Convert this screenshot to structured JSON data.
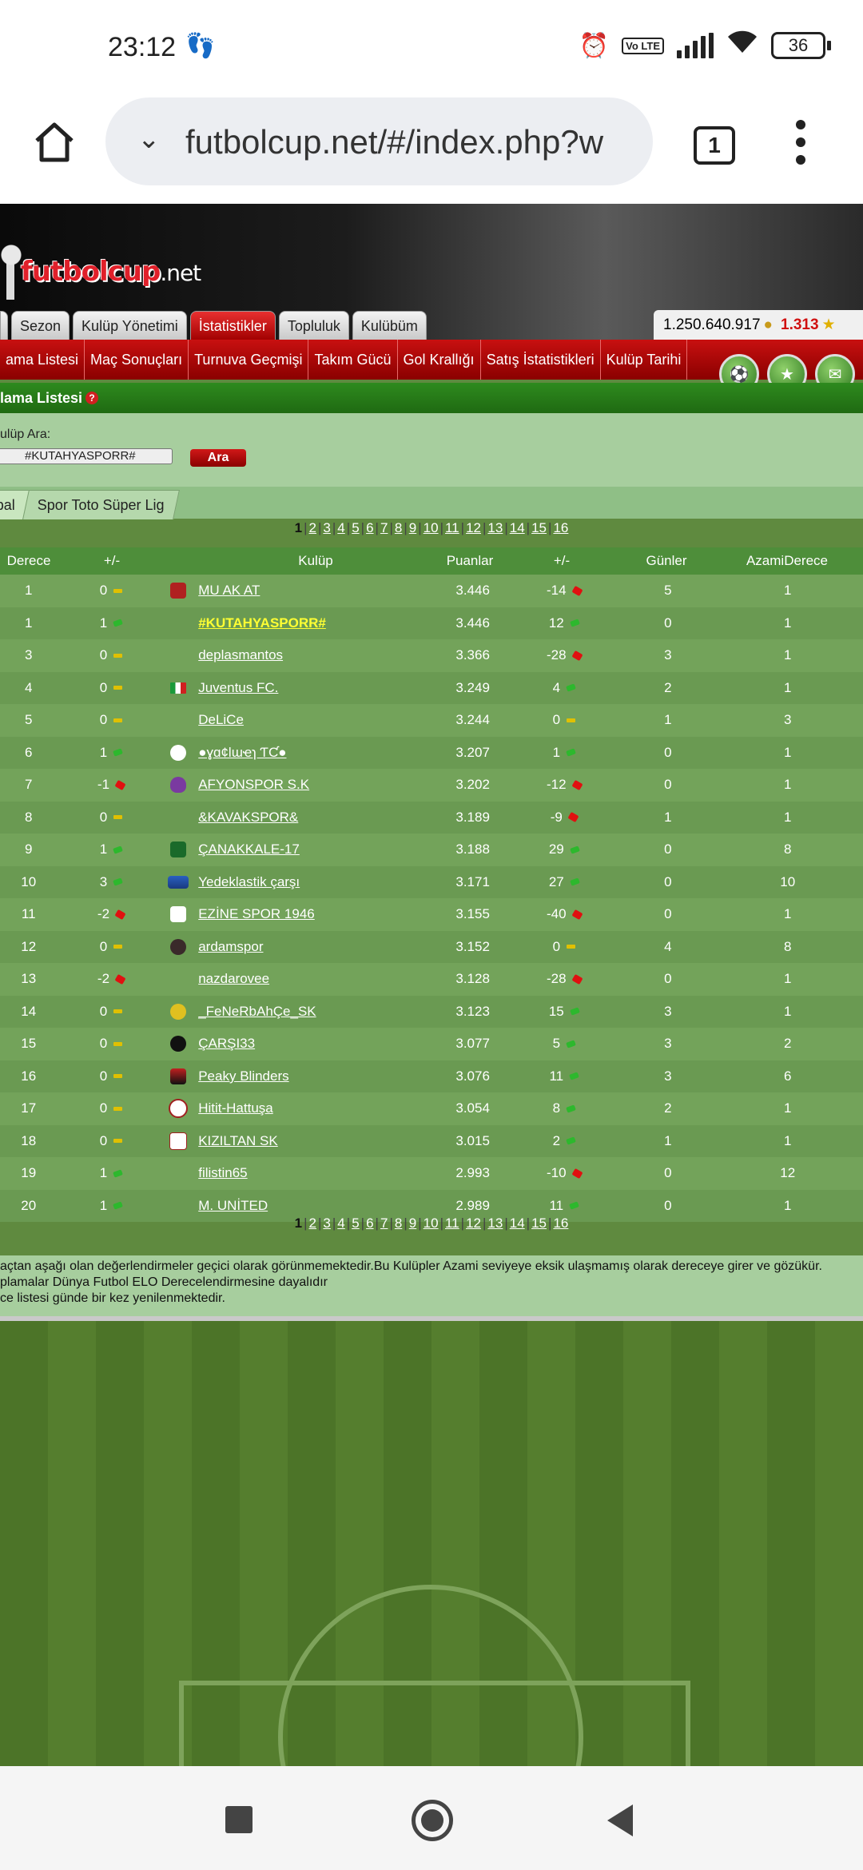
{
  "status": {
    "time": "23:12",
    "battery": "36",
    "volte": "Vo LTE"
  },
  "browser": {
    "url": "futbolcup.net/#/index.php?w",
    "tab_count": "1"
  },
  "site": {
    "logo": "futbolcup",
    "logo_suffix": ".net",
    "tabs": [
      {
        "label": "Sezon",
        "active": false
      },
      {
        "label": "Kulüp Yönetimi",
        "active": false
      },
      {
        "label": "İstatistikler",
        "active": true
      },
      {
        "label": "Topluluk",
        "active": false
      },
      {
        "label": "Kulübüm",
        "active": false
      }
    ],
    "money": "1.250.640.917",
    "points": "1.313",
    "subnav": [
      "ama Listesi",
      "Maç Sonuçları",
      "Turnuva Geçmişi",
      "Takım Gücü",
      "Gol Krallığı",
      "Satış İstatistikleri",
      "Kulüp Tarihi"
    ],
    "section_title": "lama Listesi",
    "search": {
      "label": "ulüp Ara:",
      "value": "#KUTAHYASPORR#",
      "button": "Ara"
    },
    "league_tabs": [
      {
        "label": "bal",
        "active": true
      },
      {
        "label": "Spor Toto Süper Lig",
        "active": false
      }
    ],
    "pager": {
      "current": "1",
      "pages": [
        "2",
        "3",
        "4",
        "5",
        "6",
        "7",
        "8",
        "9",
        "10",
        "11",
        "12",
        "13",
        "14",
        "15",
        "16"
      ]
    },
    "table": {
      "headers": {
        "derece": "Derece",
        "pm": "+/-",
        "club": "Kulüp",
        "puan": "Puanlar",
        "pm2": "+/-",
        "gun": "Günler",
        "azami": "AzamiDerece"
      },
      "rows": [
        {
          "derece": "1",
          "pm": "0",
          "pm_dir": "eq",
          "logo": "red",
          "club": "MU AK AT",
          "hl": false,
          "puan": "3.446",
          "pm2": "-14",
          "pm2_dir": "down",
          "gun": "5",
          "azami": "1"
        },
        {
          "derece": "1",
          "pm": "1",
          "pm_dir": "up",
          "logo": "",
          "club": "#KUTAHYASPORR#",
          "hl": true,
          "puan": "3.446",
          "pm2": "12",
          "pm2_dir": "up",
          "gun": "0",
          "azami": "1"
        },
        {
          "derece": "3",
          "pm": "0",
          "pm_dir": "eq",
          "logo": "",
          "club": "deplasmantos",
          "hl": false,
          "puan": "3.366",
          "pm2": "-28",
          "pm2_dir": "down",
          "gun": "3",
          "azami": "1"
        },
        {
          "derece": "4",
          "pm": "0",
          "pm_dir": "eq",
          "logo": "italy",
          "club": "Juventus FC.",
          "hl": false,
          "puan": "3.249",
          "pm2": "4",
          "pm2_dir": "up",
          "gun": "2",
          "azami": "1"
        },
        {
          "derece": "5",
          "pm": "0",
          "pm_dir": "eq",
          "logo": "",
          "club": "DeLiCe",
          "hl": false,
          "puan": "3.244",
          "pm2": "0",
          "pm2_dir": "eq",
          "gun": "1",
          "azami": "3"
        },
        {
          "derece": "6",
          "pm": "1",
          "pm_dir": "up",
          "logo": "ball",
          "club": "●ɣɑ¢Ɩɯҽɿ ƬƇ●",
          "hl": false,
          "puan": "3.207",
          "pm2": "1",
          "pm2_dir": "up",
          "gun": "0",
          "azami": "1"
        },
        {
          "derece": "7",
          "pm": "-1",
          "pm_dir": "down",
          "logo": "purple",
          "club": "AFYONSPOR S.K",
          "hl": false,
          "puan": "3.202",
          "pm2": "-12",
          "pm2_dir": "down",
          "gun": "0",
          "azami": "1"
        },
        {
          "derece": "8",
          "pm": "0",
          "pm_dir": "eq",
          "logo": "",
          "club": "&KAVAKSPOR&",
          "hl": false,
          "puan": "3.189",
          "pm2": "-9",
          "pm2_dir": "down",
          "gun": "1",
          "azami": "1"
        },
        {
          "derece": "9",
          "pm": "1",
          "pm_dir": "up",
          "logo": "green",
          "club": "ÇANAKKALE-17",
          "hl": false,
          "puan": "3.188",
          "pm2": "29",
          "pm2_dir": "up",
          "gun": "0",
          "azami": "8"
        },
        {
          "derece": "10",
          "pm": "3",
          "pm_dir": "up",
          "logo": "blue",
          "club": "Yedeklastik çarşı",
          "hl": false,
          "puan": "3.171",
          "pm2": "27",
          "pm2_dir": "up",
          "gun": "0",
          "azami": "10"
        },
        {
          "derece": "11",
          "pm": "-2",
          "pm_dir": "down",
          "logo": "white",
          "club": "EZİNE SPOR 1946",
          "hl": false,
          "puan": "3.155",
          "pm2": "-40",
          "pm2_dir": "down",
          "gun": "0",
          "azami": "1"
        },
        {
          "derece": "12",
          "pm": "0",
          "pm_dir": "eq",
          "logo": "dark",
          "club": "ardamspor",
          "hl": false,
          "puan": "3.152",
          "pm2": "0",
          "pm2_dir": "eq",
          "gun": "4",
          "azami": "8"
        },
        {
          "derece": "13",
          "pm": "-2",
          "pm_dir": "down",
          "logo": "",
          "club": "nazdarovee",
          "hl": false,
          "puan": "3.128",
          "pm2": "-28",
          "pm2_dir": "down",
          "gun": "0",
          "azami": "1"
        },
        {
          "derece": "14",
          "pm": "0",
          "pm_dir": "eq",
          "logo": "yellow",
          "club": "_FeNeRbAhÇe_SK",
          "hl": false,
          "puan": "3.123",
          "pm2": "15",
          "pm2_dir": "up",
          "gun": "3",
          "azami": "1"
        },
        {
          "derece": "15",
          "pm": "0",
          "pm_dir": "eq",
          "logo": "black",
          "club": "ÇARŞI33",
          "hl": false,
          "puan": "3.077",
          "pm2": "5",
          "pm2_dir": "up",
          "gun": "3",
          "azami": "2"
        },
        {
          "derece": "16",
          "pm": "0",
          "pm_dir": "eq",
          "logo": "redblack",
          "club": "Peaky Blinders",
          "hl": false,
          "puan": "3.076",
          "pm2": "11",
          "pm2_dir": "up",
          "gun": "3",
          "azami": "6"
        },
        {
          "derece": "17",
          "pm": "0",
          "pm_dir": "eq",
          "logo": "circle",
          "club": "Hitit-Hattuşa",
          "hl": false,
          "puan": "3.054",
          "pm2": "8",
          "pm2_dir": "up",
          "gun": "2",
          "azami": "1"
        },
        {
          "derece": "18",
          "pm": "0",
          "pm_dir": "eq",
          "logo": "kizil",
          "club": "KIZILTAN SK",
          "hl": false,
          "puan": "3.015",
          "pm2": "2",
          "pm2_dir": "up",
          "gun": "1",
          "azami": "1"
        },
        {
          "derece": "19",
          "pm": "1",
          "pm_dir": "up",
          "logo": "",
          "club": "filistin65",
          "hl": false,
          "puan": "2.993",
          "pm2": "-10",
          "pm2_dir": "down",
          "gun": "0",
          "azami": "12"
        },
        {
          "derece": "20",
          "pm": "1",
          "pm_dir": "up",
          "logo": "",
          "club": "M. UNİTED",
          "hl": false,
          "puan": "2.989",
          "pm2": "11",
          "pm2_dir": "up",
          "gun": "0",
          "azami": "1"
        }
      ]
    },
    "notes": [
      "açtan aşağı olan değerlendirmeler geçici olarak görünmemektedir.Bu Kulüpler Azami seviyeye eksik ulaşmamış olarak dereceye girer ve gözükür.",
      "plamalar Dünya Futbol ELO Derecelendirmesine dayalıdır",
      "ce listesi günde bir kez yenilenmektedir."
    ]
  }
}
